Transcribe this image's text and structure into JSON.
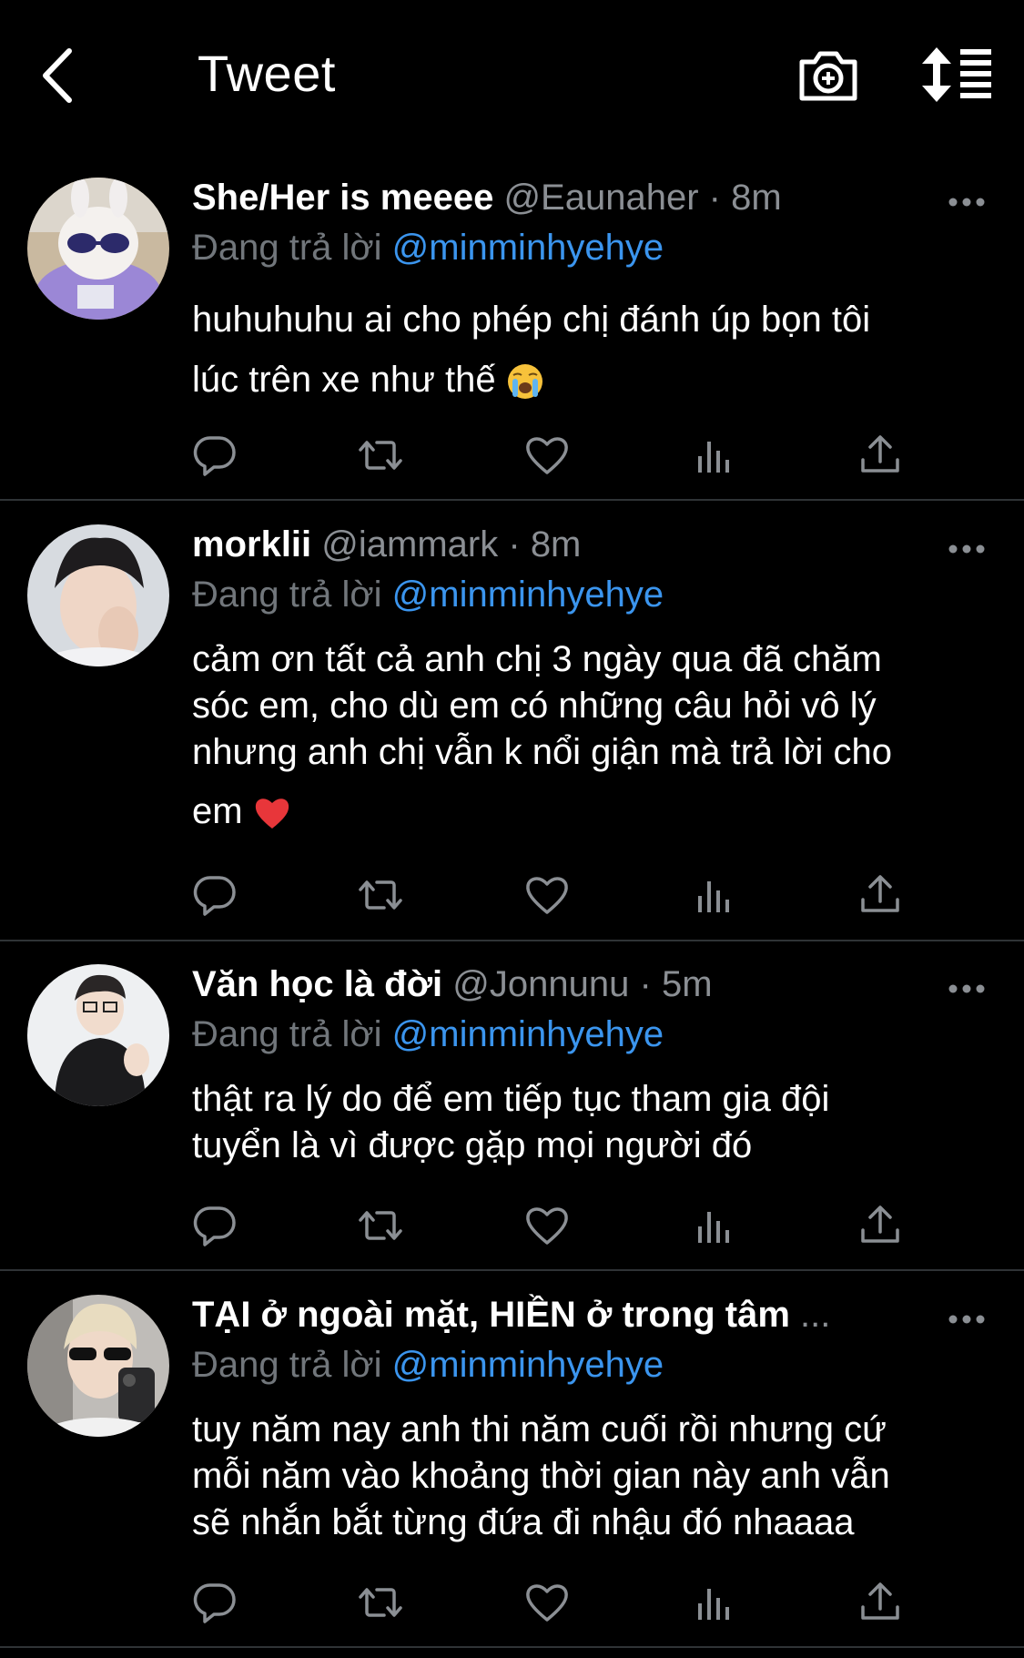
{
  "header": {
    "title": "Tweet",
    "back_icon": "chevron-left-icon",
    "camera_icon": "camera-plus-icon",
    "sort_icon": "sort-list-icon"
  },
  "colors": {
    "background": "#000000",
    "link": "#3b95ee",
    "muted": "#71767b",
    "divider": "#2f3336"
  },
  "tweets": [
    {
      "name": "She/Her is meeee",
      "handle": "@Eaunaher",
      "time_sep": "·",
      "time": "8m",
      "reply_prefix": "Đang trả lời",
      "reply_to": "@minminhyehye",
      "lines": [
        "huhuhuhu ai cho phép chị đánh úp bọn tôi",
        "lúc trên xe như thế"
      ],
      "emoji": "loudly-crying-face"
    },
    {
      "name": "morklii",
      "handle": "@iammark",
      "time_sep": "·",
      "time": "8m",
      "reply_prefix": "Đang trả lời",
      "reply_to": "@minminhyehye",
      "lines": [
        "cảm ơn tất cả anh chị 3 ngày qua đã chăm",
        "sóc em, cho dù em có những câu hỏi vô lý",
        "nhưng anh chị vẫn k nổi giận mà trả lời cho",
        "em"
      ],
      "emoji": "red-heart"
    },
    {
      "name": "Văn học là đời",
      "handle": "@Jonnunu",
      "time_sep": "·",
      "time": "5m",
      "reply_prefix": "Đang trả lời",
      "reply_to": "@minminhyehye",
      "lines": [
        "thật ra lý do để em tiếp tục tham gia đội",
        "tuyển là vì được gặp mọi người đó"
      ]
    },
    {
      "name": "TẠI ở ngoài mặt, HIỀN ở trong tâm",
      "handle": "...",
      "time_sep": "",
      "time": "",
      "reply_prefix": "Đang trả lời",
      "reply_to": "@minminhyehye",
      "lines": [
        "tuy năm nay anh thi năm cuối rồi nhưng cứ",
        "mỗi năm vào khoảng thời gian này anh vẫn",
        "sẽ nhắn bắt từng đứa đi nhậu đó nhaaaa"
      ]
    }
  ]
}
